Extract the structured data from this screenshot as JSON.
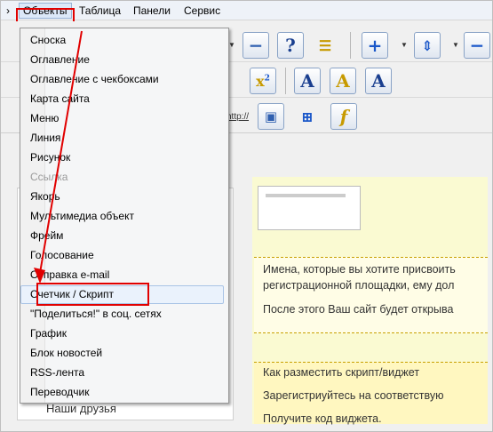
{
  "menubar": {
    "chevron": "›",
    "items": [
      {
        "label": "Объекты",
        "active": true
      },
      {
        "label": "Таблица"
      },
      {
        "label": "Панели"
      },
      {
        "label": "Сервис"
      }
    ]
  },
  "toolbar": {
    "link_label": "http://"
  },
  "dropdown": {
    "items": [
      {
        "label": "Сноска"
      },
      {
        "label": "Оглавление"
      },
      {
        "label": "Оглавление с чекбоксами"
      },
      {
        "label": "Карта сайта"
      },
      {
        "label": "Меню"
      },
      {
        "label": "Линия"
      },
      {
        "label": "Рисунок"
      },
      {
        "label": "Ссылка",
        "disabled": true
      },
      {
        "label": "Якорь"
      },
      {
        "label": "Мультимедиа объект"
      },
      {
        "label": "Фрейм"
      },
      {
        "label": "Голосование"
      },
      {
        "label": "Отправка e-mail"
      },
      {
        "label": "Счетчик / Скрипт",
        "highlighted": true
      },
      {
        "label": "\"Поделиться!\" в соц. сетях"
      },
      {
        "label": "График"
      },
      {
        "label": "Блок новостей"
      },
      {
        "label": "RSS-лента"
      },
      {
        "label": "Переводчик"
      }
    ]
  },
  "sidebar": {
    "last_item": "Наши друзья"
  },
  "content": {
    "block1": [
      "Имена, которые вы хотите присвоить",
      "регистрационной площадки, ему дол",
      "После этого Ваш сайт будет открыва"
    ],
    "block2": [
      "Как разместить скрипт/виджет",
      "Зарегистриуйтесь на соответствую",
      "Получите код виджета."
    ]
  },
  "colors": {
    "accent_red": "#e10000",
    "highlight": "#eaf2fc",
    "content_bg": "#fafad2"
  }
}
